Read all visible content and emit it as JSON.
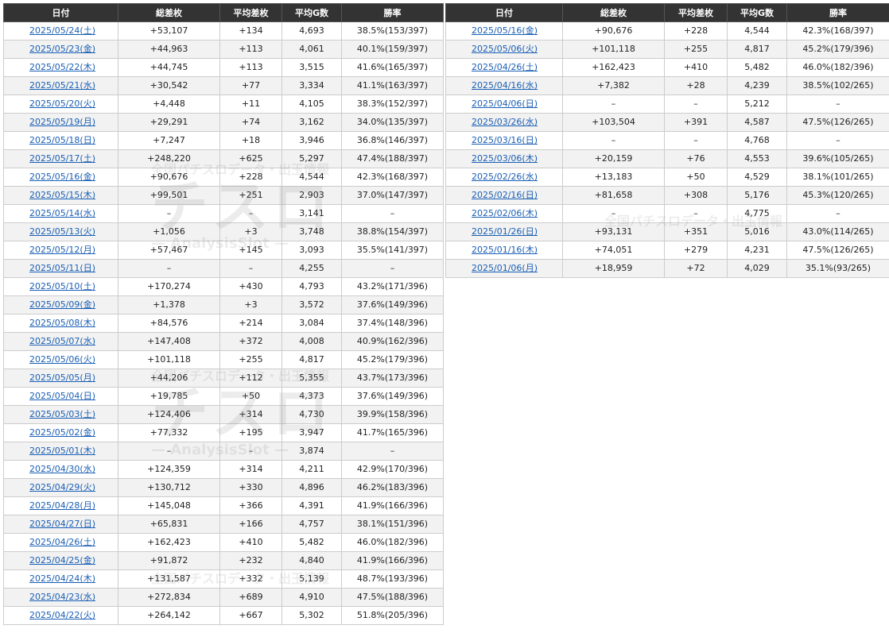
{
  "left_table": {
    "headers": [
      "日付",
      "総差枚",
      "平均差枚",
      "平均G数",
      "勝率"
    ],
    "rows": [
      {
        "date": "2025/05/24(土)",
        "diff": "+53,107",
        "avg_diff": "+134",
        "avg_g": "4,693",
        "win": "38.5%(153/397)"
      },
      {
        "date": "2025/05/23(金)",
        "diff": "+44,963",
        "avg_diff": "+113",
        "avg_g": "4,061",
        "win": "40.1%(159/397)"
      },
      {
        "date": "2025/05/22(木)",
        "diff": "+44,745",
        "avg_diff": "+113",
        "avg_g": "3,515",
        "win": "41.6%(165/397)"
      },
      {
        "date": "2025/05/21(水)",
        "diff": "+30,542",
        "avg_diff": "+77",
        "avg_g": "3,334",
        "win": "41.1%(163/397)"
      },
      {
        "date": "2025/05/20(火)",
        "diff": "+4,448",
        "avg_diff": "+11",
        "avg_g": "4,105",
        "win": "38.3%(152/397)"
      },
      {
        "date": "2025/05/19(月)",
        "diff": "+29,291",
        "avg_diff": "+74",
        "avg_g": "3,162",
        "win": "34.0%(135/397)"
      },
      {
        "date": "2025/05/18(日)",
        "diff": "+7,247",
        "avg_diff": "+18",
        "avg_g": "3,946",
        "win": "36.8%(146/397)"
      },
      {
        "date": "2025/05/17(土)",
        "diff": "+248,220",
        "avg_diff": "+625",
        "avg_g": "5,297",
        "win": "47.4%(188/397)"
      },
      {
        "date": "2025/05/16(金)",
        "diff": "+90,676",
        "avg_diff": "+228",
        "avg_g": "4,544",
        "win": "42.3%(168/397)"
      },
      {
        "date": "2025/05/15(木)",
        "diff": "+99,501",
        "avg_diff": "+251",
        "avg_g": "2,903",
        "win": "37.0%(147/397)"
      },
      {
        "date": "2025/05/14(水)",
        "diff": "–",
        "avg_diff": "–",
        "avg_g": "3,141",
        "win": "–"
      },
      {
        "date": "2025/05/13(火)",
        "diff": "+1,056",
        "avg_diff": "+3",
        "avg_g": "3,748",
        "win": "38.8%(154/397)"
      },
      {
        "date": "2025/05/12(月)",
        "diff": "+57,467",
        "avg_diff": "+145",
        "avg_g": "3,093",
        "win": "35.5%(141/397)"
      },
      {
        "date": "2025/05/11(日)",
        "diff": "–",
        "avg_diff": "–",
        "avg_g": "4,255",
        "win": "–"
      },
      {
        "date": "2025/05/10(土)",
        "diff": "+170,274",
        "avg_diff": "+430",
        "avg_g": "4,793",
        "win": "43.2%(171/396)"
      },
      {
        "date": "2025/05/09(金)",
        "diff": "+1,378",
        "avg_diff": "+3",
        "avg_g": "3,572",
        "win": "37.6%(149/396)"
      },
      {
        "date": "2025/05/08(木)",
        "diff": "+84,576",
        "avg_diff": "+214",
        "avg_g": "3,084",
        "win": "37.4%(148/396)"
      },
      {
        "date": "2025/05/07(水)",
        "diff": "+147,408",
        "avg_diff": "+372",
        "avg_g": "4,008",
        "win": "40.9%(162/396)"
      },
      {
        "date": "2025/05/06(火)",
        "diff": "+101,118",
        "avg_diff": "+255",
        "avg_g": "4,817",
        "win": "45.2%(179/396)"
      },
      {
        "date": "2025/05/05(月)",
        "diff": "+44,206",
        "avg_diff": "+112",
        "avg_g": "5,355",
        "win": "43.7%(173/396)"
      },
      {
        "date": "2025/05/04(日)",
        "diff": "+19,785",
        "avg_diff": "+50",
        "avg_g": "4,373",
        "win": "37.6%(149/396)"
      },
      {
        "date": "2025/05/03(土)",
        "diff": "+124,406",
        "avg_diff": "+314",
        "avg_g": "4,730",
        "win": "39.9%(158/396)"
      },
      {
        "date": "2025/05/02(金)",
        "diff": "+77,332",
        "avg_diff": "+195",
        "avg_g": "3,947",
        "win": "41.7%(165/396)"
      },
      {
        "date": "2025/05/01(木)",
        "diff": "–",
        "avg_diff": "–",
        "avg_g": "3,874",
        "win": "–"
      },
      {
        "date": "2025/04/30(水)",
        "diff": "+124,359",
        "avg_diff": "+314",
        "avg_g": "4,211",
        "win": "42.9%(170/396)"
      },
      {
        "date": "2025/04/29(火)",
        "diff": "+130,712",
        "avg_diff": "+330",
        "avg_g": "4,896",
        "win": "46.2%(183/396)"
      },
      {
        "date": "2025/04/28(月)",
        "diff": "+145,048",
        "avg_diff": "+366",
        "avg_g": "4,391",
        "win": "41.9%(166/396)"
      },
      {
        "date": "2025/04/27(日)",
        "diff": "+65,831",
        "avg_diff": "+166",
        "avg_g": "4,757",
        "win": "38.1%(151/396)"
      },
      {
        "date": "2025/04/26(土)",
        "diff": "+162,423",
        "avg_diff": "+410",
        "avg_g": "5,482",
        "win": "46.0%(182/396)"
      },
      {
        "date": "2025/04/25(金)",
        "diff": "+91,872",
        "avg_diff": "+232",
        "avg_g": "4,840",
        "win": "41.9%(166/396)"
      },
      {
        "date": "2025/04/24(木)",
        "diff": "+131,587",
        "avg_diff": "+332",
        "avg_g": "5,139",
        "win": "48.7%(193/396)"
      },
      {
        "date": "2025/04/23(水)",
        "diff": "+272,834",
        "avg_diff": "+689",
        "avg_g": "4,910",
        "win": "47.5%(188/396)"
      },
      {
        "date": "2025/04/22(火)",
        "diff": "+264,142",
        "avg_diff": "+667",
        "avg_g": "5,302",
        "win": "51.8%(205/396)"
      }
    ]
  },
  "right_table": {
    "headers": [
      "日付",
      "総差枚",
      "平均差枚",
      "平均G数",
      "勝率"
    ],
    "rows": [
      {
        "date": "2025/05/16(金)",
        "diff": "+90,676",
        "avg_diff": "+228",
        "avg_g": "4,544",
        "win": "42.3%(168/397)"
      },
      {
        "date": "2025/05/06(火)",
        "diff": "+101,118",
        "avg_diff": "+255",
        "avg_g": "4,817",
        "win": "45.2%(179/396)"
      },
      {
        "date": "2025/04/26(土)",
        "diff": "+162,423",
        "avg_diff": "+410",
        "avg_g": "5,482",
        "win": "46.0%(182/396)"
      },
      {
        "date": "2025/04/16(水)",
        "diff": "+7,382",
        "avg_diff": "+28",
        "avg_g": "4,239",
        "win": "38.5%(102/265)"
      },
      {
        "date": "2025/04/06(日)",
        "diff": "–",
        "avg_diff": "–",
        "avg_g": "5,212",
        "win": "–"
      },
      {
        "date": "2025/03/26(水)",
        "diff": "+103,504",
        "avg_diff": "+391",
        "avg_g": "4,587",
        "win": "47.5%(126/265)"
      },
      {
        "date": "2025/03/16(日)",
        "diff": "–",
        "avg_diff": "–",
        "avg_g": "4,768",
        "win": "–"
      },
      {
        "date": "2025/03/06(木)",
        "diff": "+20,159",
        "avg_diff": "+76",
        "avg_g": "4,553",
        "win": "39.6%(105/265)"
      },
      {
        "date": "2025/02/26(水)",
        "diff": "+13,183",
        "avg_diff": "+50",
        "avg_g": "4,529",
        "win": "38.1%(101/265)"
      },
      {
        "date": "2025/02/16(日)",
        "diff": "+81,658",
        "avg_diff": "+308",
        "avg_g": "5,176",
        "win": "45.3%(120/265)"
      },
      {
        "date": "2025/02/06(木)",
        "diff": "–",
        "avg_diff": "–",
        "avg_g": "4,775",
        "win": "–"
      },
      {
        "date": "2025/01/26(日)",
        "diff": "+93,131",
        "avg_diff": "+351",
        "avg_g": "5,016",
        "win": "43.0%(114/265)"
      },
      {
        "date": "2025/01/16(木)",
        "diff": "+74,051",
        "avg_diff": "+279",
        "avg_g": "4,231",
        "win": "47.5%(126/265)"
      },
      {
        "date": "2025/01/06(月)",
        "diff": "+18,959",
        "avg_diff": "+72",
        "avg_g": "4,029",
        "win": "35.1%(93/265)"
      }
    ]
  },
  "watermark": {
    "top_text": "全国パチスロデータ・出玉情報",
    "logo_text": "チスロ",
    "sub_text": "— AnalysisSlot —"
  },
  "colors": {
    "header_bg": "#333333",
    "header_text": "#ffffff",
    "link": "#1a5fb4",
    "row_alt": "#f2f2f2",
    "border": "#cccccc"
  }
}
